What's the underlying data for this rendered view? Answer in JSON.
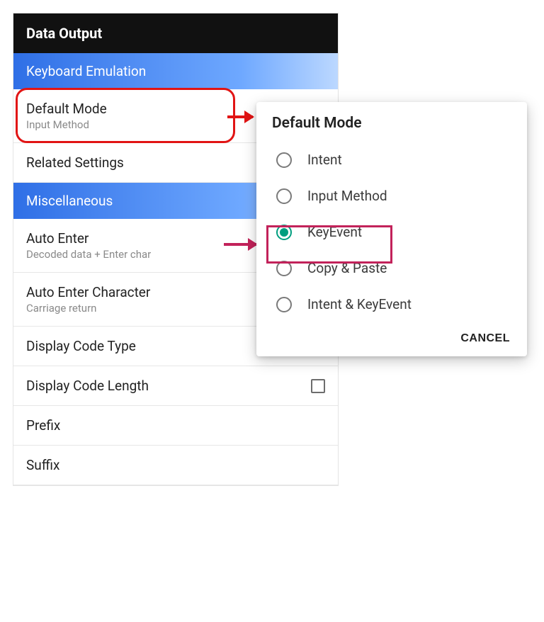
{
  "title": "Data Output",
  "sections": {
    "keyboard": {
      "header": "Keyboard Emulation",
      "default_mode": {
        "label": "Default Mode",
        "value": "Input Method"
      },
      "related_settings": {
        "label": "Related Settings"
      }
    },
    "misc": {
      "header": "Miscellaneous",
      "auto_enter": {
        "label": "Auto Enter",
        "value": "Decoded data + Enter char"
      },
      "auto_enter_char": {
        "label": "Auto Enter Character",
        "value": "Carriage return"
      },
      "display_code_type": {
        "label": "Display Code Type"
      },
      "display_code_length": {
        "label": "Display Code Length"
      },
      "prefix": {
        "label": "Prefix"
      },
      "suffix": {
        "label": "Suffix"
      }
    }
  },
  "dialog": {
    "title": "Default Mode",
    "options": {
      "intent": "Intent",
      "input_method": "Input Method",
      "keyevent": "KeyEvent",
      "copy_paste": "Copy & Paste",
      "intent_keyevent": "Intent & KeyEvent"
    },
    "selected": "keyevent",
    "cancel": "CANCEL"
  }
}
